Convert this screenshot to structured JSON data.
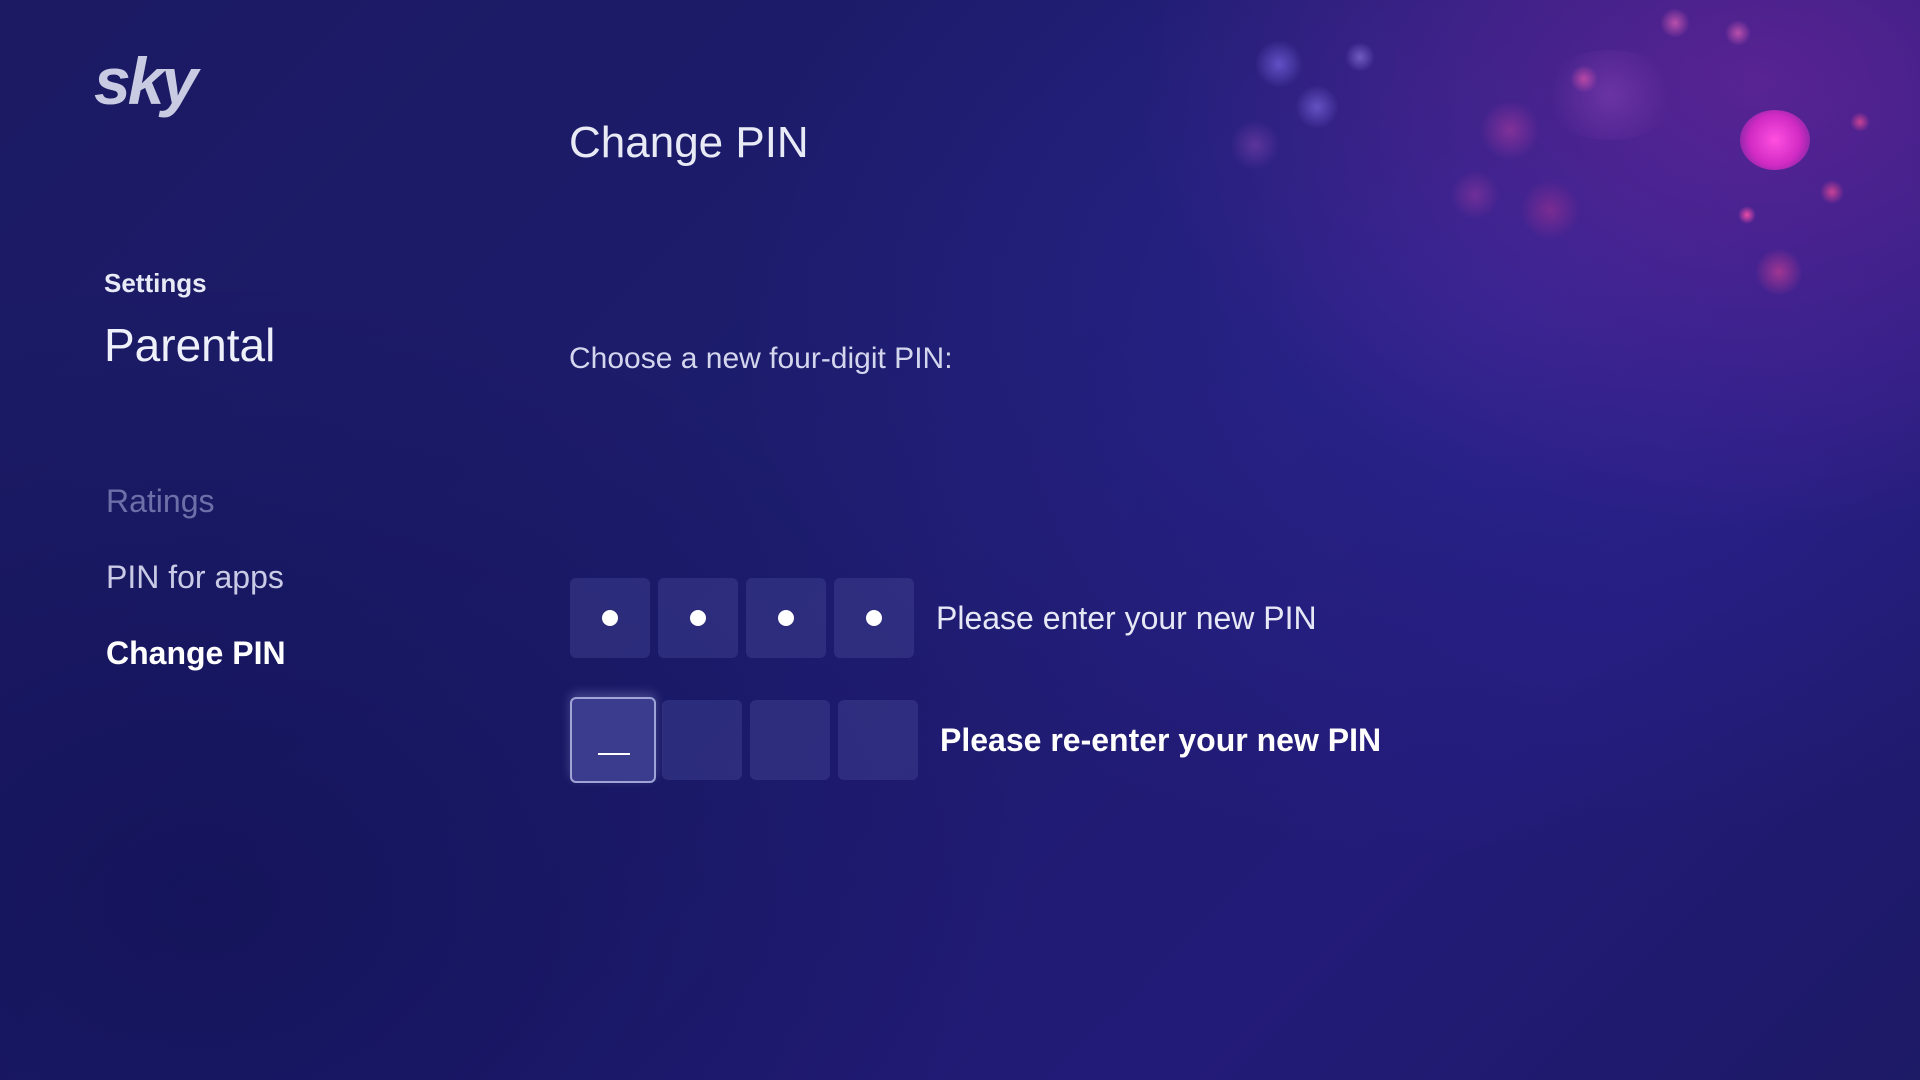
{
  "brand": {
    "logo_text": "sky",
    "logo_color": "#c9cbe2"
  },
  "sidebar": {
    "eyebrow": "Settings",
    "title": "Parental",
    "items": [
      {
        "label": "Ratings",
        "state": "dimmed"
      },
      {
        "label": "PIN for apps",
        "state": "normal"
      },
      {
        "label": "Change PIN",
        "state": "selected"
      }
    ]
  },
  "main": {
    "title": "Change PIN",
    "instruction": "Choose a new four-digit PIN:",
    "new_pin": {
      "label": "Please enter your new PIN",
      "digits_entered": 4,
      "digits_total": 4
    },
    "confirm_pin": {
      "label": "Please re-enter your new PIN",
      "digits_entered": 0,
      "digits_total": 4,
      "focused_index": 0
    }
  },
  "colors": {
    "background": "#1d1c6e",
    "accent_magenta": "#e23bd0",
    "text_primary": "#ffffff",
    "text_dimmed": "#6d6fa8"
  }
}
